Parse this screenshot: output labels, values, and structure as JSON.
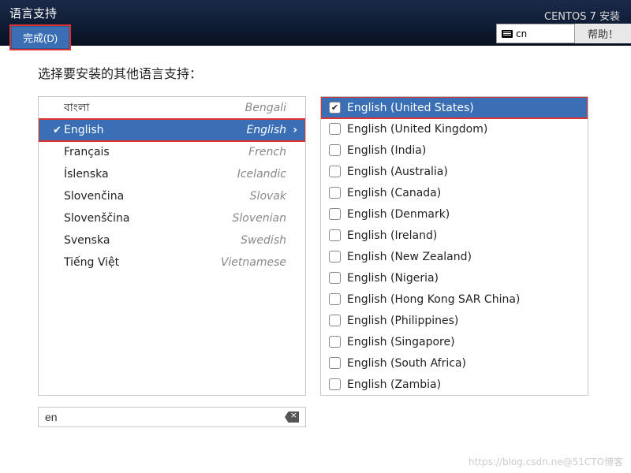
{
  "header": {
    "title_cn": "语言支持",
    "done_label": "完成(D)",
    "centos_label": "CENTOS 7 安装",
    "keyboard_layout": "cn",
    "help_label": "帮助！"
  },
  "prompt": "选择要安装的其他语言支持：",
  "languages": [
    {
      "native": "বাংলা",
      "english": "Bengali",
      "selected": false
    },
    {
      "native": "English",
      "english": "English",
      "selected": true,
      "highlighted": true
    },
    {
      "native": "Français",
      "english": "French",
      "selected": false
    },
    {
      "native": "Íslenska",
      "english": "Icelandic",
      "selected": false
    },
    {
      "native": "Slovenčina",
      "english": "Slovak",
      "selected": false
    },
    {
      "native": "Slovenščina",
      "english": "Slovenian",
      "selected": false
    },
    {
      "native": "Svenska",
      "english": "Swedish",
      "selected": false
    },
    {
      "native": "Tiếng Việt",
      "english": "Vietnamese",
      "selected": false
    }
  ],
  "locales": [
    {
      "label": "English (United States)",
      "checked": true,
      "selected": true,
      "highlighted": true
    },
    {
      "label": "English (United Kingdom)",
      "checked": false
    },
    {
      "label": "English (India)",
      "checked": false
    },
    {
      "label": "English (Australia)",
      "checked": false
    },
    {
      "label": "English (Canada)",
      "checked": false
    },
    {
      "label": "English (Denmark)",
      "checked": false
    },
    {
      "label": "English (Ireland)",
      "checked": false
    },
    {
      "label": "English (New Zealand)",
      "checked": false
    },
    {
      "label": "English (Nigeria)",
      "checked": false
    },
    {
      "label": "English (Hong Kong SAR China)",
      "checked": false
    },
    {
      "label": "English (Philippines)",
      "checked": false
    },
    {
      "label": "English (Singapore)",
      "checked": false
    },
    {
      "label": "English (South Africa)",
      "checked": false
    },
    {
      "label": "English (Zambia)",
      "checked": false
    }
  ],
  "search": {
    "value": "en"
  },
  "watermark": "https://blog.csdn.ne@51CTO博客"
}
